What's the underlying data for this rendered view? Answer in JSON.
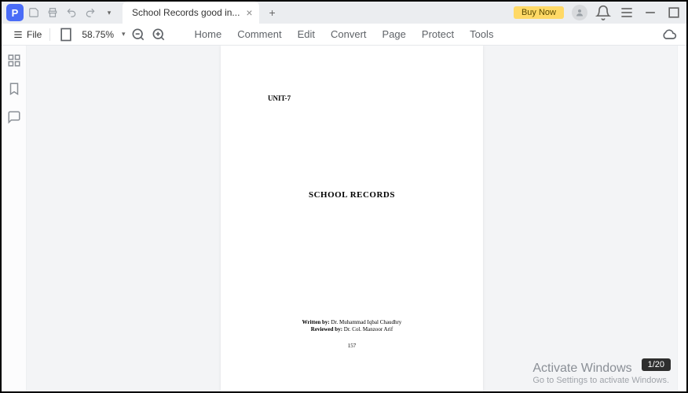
{
  "titlebar": {
    "tab_title": "School Records good in...",
    "buy_now": "Buy Now"
  },
  "toolbar": {
    "file_label": "File",
    "zoom": "58.75%"
  },
  "menu": {
    "items": [
      "Home",
      "Comment",
      "Edit",
      "Convert",
      "Page",
      "Protect",
      "Tools"
    ]
  },
  "document": {
    "unit": "UNIT-7",
    "title": "SCHOOL RECORDS",
    "written_label": "Written by:",
    "written_value": " Dr. Muhammad Iqbal Chaudhry",
    "reviewed_label": "Reviewed by:",
    "reviewed_value": " Dr. Col. Manzoor Arif",
    "page_number": "157"
  },
  "page_indicator": "1/20",
  "watermark": {
    "title": "Activate Windows",
    "subtitle": "Go to Settings to activate Windows."
  }
}
